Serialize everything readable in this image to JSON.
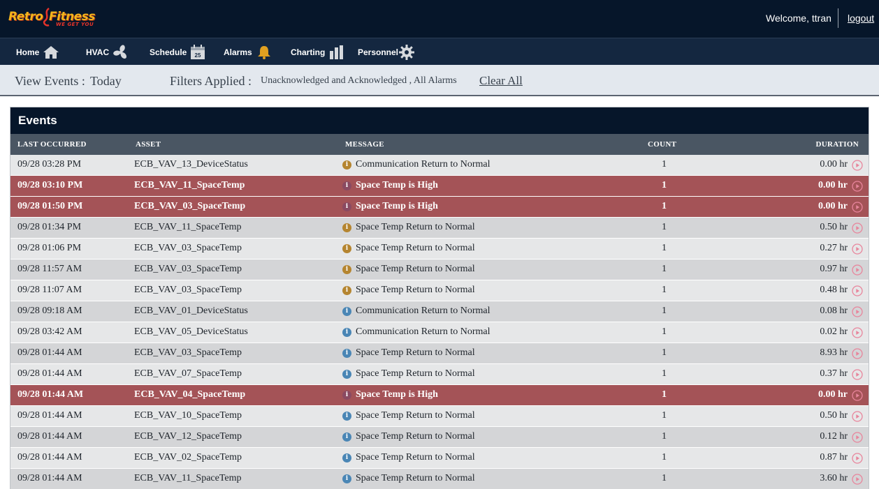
{
  "header": {
    "logo": {
      "line1": "Retro",
      "line2": "Fitness",
      "tagline": "WE GET YOU"
    },
    "welcome": "Welcome, ttran",
    "logout": "logout"
  },
  "nav": {
    "items": [
      {
        "label": "Home",
        "icon": "home-icon"
      },
      {
        "label": "HVAC",
        "icon": "fan-icon"
      },
      {
        "label": "Schedule",
        "icon": "calendar-icon",
        "badge": "25"
      },
      {
        "label": "Alarms",
        "icon": "bell-icon"
      },
      {
        "label": "Charting",
        "icon": "bar-chart-icon"
      },
      {
        "label": "Personnel",
        "icon": "gear-icon"
      }
    ]
  },
  "filters": {
    "view_label": "View Events :",
    "view_value": "Today",
    "applied_label": "Filters Applied :",
    "applied_value": "Unacknowledged and Acknowledged , All Alarms",
    "clear_all": "Clear All"
  },
  "events": {
    "title": "Events",
    "columns": [
      "LAST OCCURRED",
      "ASSET",
      "MESSAGE",
      "COUNT",
      "DURATION"
    ],
    "rows": [
      {
        "date": "09/28 03:28 PM",
        "asset": "ECB_VAV_13_DeviceStatus",
        "message": "Communication Return to Normal",
        "count": "1",
        "duration": "0.00 hr",
        "status": "normal",
        "icon_color": "#b58530"
      },
      {
        "date": "09/28 03:10 PM",
        "asset": "ECB_VAV_11_SpaceTemp",
        "message": "Space Temp is High",
        "count": "1",
        "duration": "0.00 hr",
        "status": "alarm",
        "icon_color": "#8a4a62"
      },
      {
        "date": "09/28 01:50 PM",
        "asset": "ECB_VAV_03_SpaceTemp",
        "message": "Space Temp is High",
        "count": "1",
        "duration": "0.00 hr",
        "status": "alarm",
        "icon_color": "#8a4a62"
      },
      {
        "date": "09/28 01:34 PM",
        "asset": "ECB_VAV_11_SpaceTemp",
        "message": "Space Temp Return to Normal",
        "count": "1",
        "duration": "0.50 hr",
        "status": "normal",
        "icon_color": "#b58530"
      },
      {
        "date": "09/28 01:06 PM",
        "asset": "ECB_VAV_03_SpaceTemp",
        "message": "Space Temp Return to Normal",
        "count": "1",
        "duration": "0.27 hr",
        "status": "normal",
        "icon_color": "#b58530"
      },
      {
        "date": "09/28 11:57 AM",
        "asset": "ECB_VAV_03_SpaceTemp",
        "message": "Space Temp Return to Normal",
        "count": "1",
        "duration": "0.97 hr",
        "status": "normal",
        "icon_color": "#b58530"
      },
      {
        "date": "09/28 11:07 AM",
        "asset": "ECB_VAV_03_SpaceTemp",
        "message": "Space Temp Return to Normal",
        "count": "1",
        "duration": "0.48 hr",
        "status": "normal",
        "icon_color": "#b58530"
      },
      {
        "date": "09/28 09:18 AM",
        "asset": "ECB_VAV_01_DeviceStatus",
        "message": "Communication Return to Normal",
        "count": "1",
        "duration": "0.08 hr",
        "status": "normal",
        "icon_color": "#4a86b5"
      },
      {
        "date": "09/28 03:42 AM",
        "asset": "ECB_VAV_05_DeviceStatus",
        "message": "Communication Return to Normal",
        "count": "1",
        "duration": "0.02 hr",
        "status": "normal",
        "icon_color": "#4a86b5"
      },
      {
        "date": "09/28 01:44 AM",
        "asset": "ECB_VAV_03_SpaceTemp",
        "message": "Space Temp Return to Normal",
        "count": "1",
        "duration": "8.93 hr",
        "status": "normal",
        "icon_color": "#4a86b5"
      },
      {
        "date": "09/28 01:44 AM",
        "asset": "ECB_VAV_07_SpaceTemp",
        "message": "Space Temp Return to Normal",
        "count": "1",
        "duration": "0.37 hr",
        "status": "normal",
        "icon_color": "#4a86b5"
      },
      {
        "date": "09/28 01:44 AM",
        "asset": "ECB_VAV_04_SpaceTemp",
        "message": "Space Temp is High",
        "count": "1",
        "duration": "0.00 hr",
        "status": "alarm",
        "icon_color": "#8a4a62"
      },
      {
        "date": "09/28 01:44 AM",
        "asset": "ECB_VAV_10_SpaceTemp",
        "message": "Space Temp Return to Normal",
        "count": "1",
        "duration": "0.50 hr",
        "status": "normal",
        "icon_color": "#4a86b5"
      },
      {
        "date": "09/28 01:44 AM",
        "asset": "ECB_VAV_12_SpaceTemp",
        "message": "Space Temp Return to Normal",
        "count": "1",
        "duration": "0.12 hr",
        "status": "normal",
        "icon_color": "#4a86b5"
      },
      {
        "date": "09/28 01:44 AM",
        "asset": "ECB_VAV_02_SpaceTemp",
        "message": "Space Temp Return to Normal",
        "count": "1",
        "duration": "0.87 hr",
        "status": "normal",
        "icon_color": "#4a86b5"
      },
      {
        "date": "09/28 01:44 AM",
        "asset": "ECB_VAV_11_SpaceTemp",
        "message": "Space Temp Return to Normal",
        "count": "1",
        "duration": "3.60 hr",
        "status": "normal",
        "icon_color": "#4a86b5"
      }
    ]
  },
  "colors": {
    "header_bg": "#06162a",
    "nav_bg": "#142740",
    "alarm_row": "#a45357",
    "play_icon": "#e8859c",
    "alarm_bell": "#e0a020"
  }
}
